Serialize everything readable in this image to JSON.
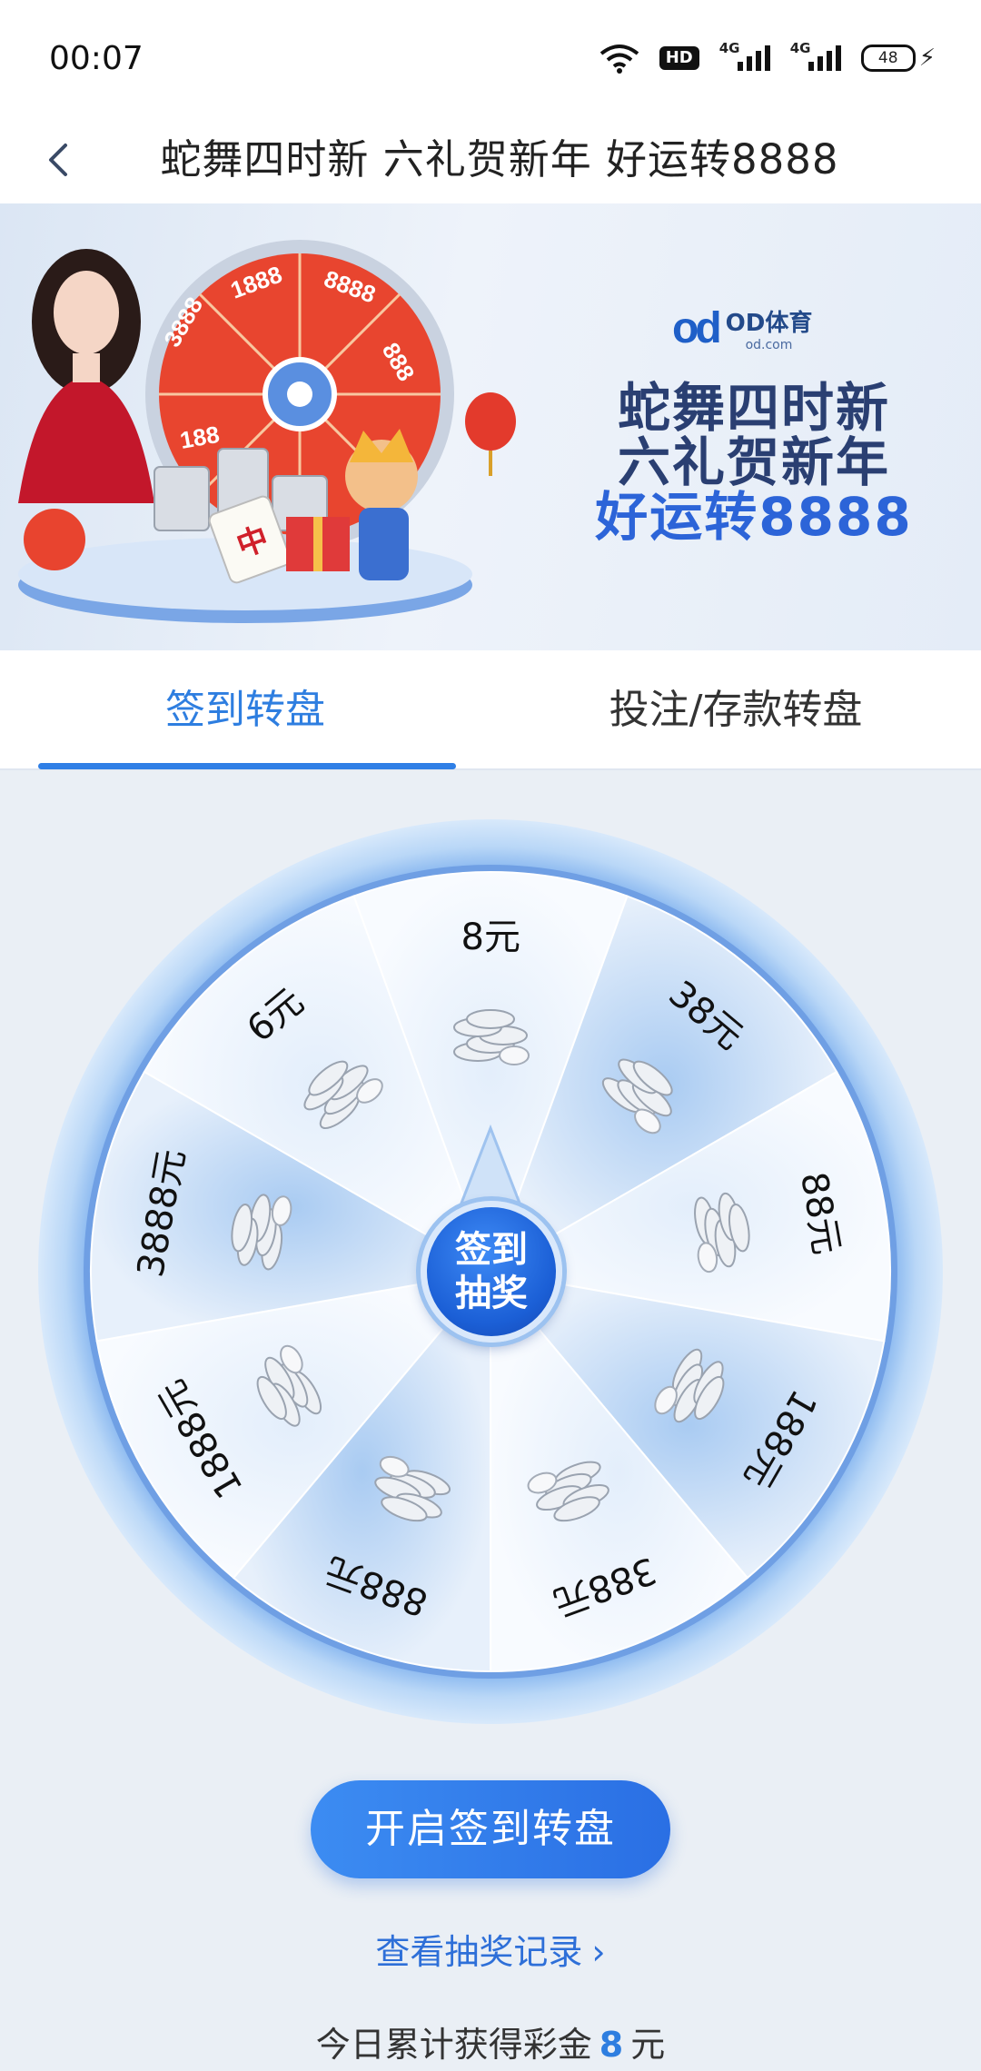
{
  "status_bar": {
    "time": "00:07",
    "hd": "HD",
    "network": "4G",
    "battery": "48"
  },
  "header": {
    "title": "蛇舞四时新 六礼贺新年 好运转8888"
  },
  "banner": {
    "brand_mark": "od",
    "brand_name": "OD体育",
    "brand_url": "od.com",
    "line1": "蛇舞四时新",
    "line2": "六礼贺新年",
    "line3": "好运转8888",
    "wheel_labels": [
      "1888",
      "3888",
      "8888",
      "888",
      "188"
    ],
    "tile_char": "中"
  },
  "tabs": [
    {
      "label": "签到转盘",
      "active": true
    },
    {
      "label": "投注/存款转盘",
      "active": false
    }
  ],
  "wheel": {
    "segments": [
      "8元",
      "38元",
      "88元",
      "188元",
      "388元",
      "888元",
      "1888元",
      "3888元",
      "6元"
    ],
    "center_button": "签到\n抽奖",
    "colors": {
      "ring": "#a9cdf5",
      "segment_light": "#f2f6fc",
      "segment_blue": "#cfe2f8",
      "center": "#1b5fd6"
    }
  },
  "actions": {
    "start_button": "开启签到转盘",
    "record_link": "查看抽奖记录"
  },
  "summary": {
    "prefix": "今日累计获得彩金",
    "amount": "8",
    "suffix": "元"
  },
  "colors": {
    "accent": "#2e7ee0",
    "background": "#eaeff5"
  }
}
